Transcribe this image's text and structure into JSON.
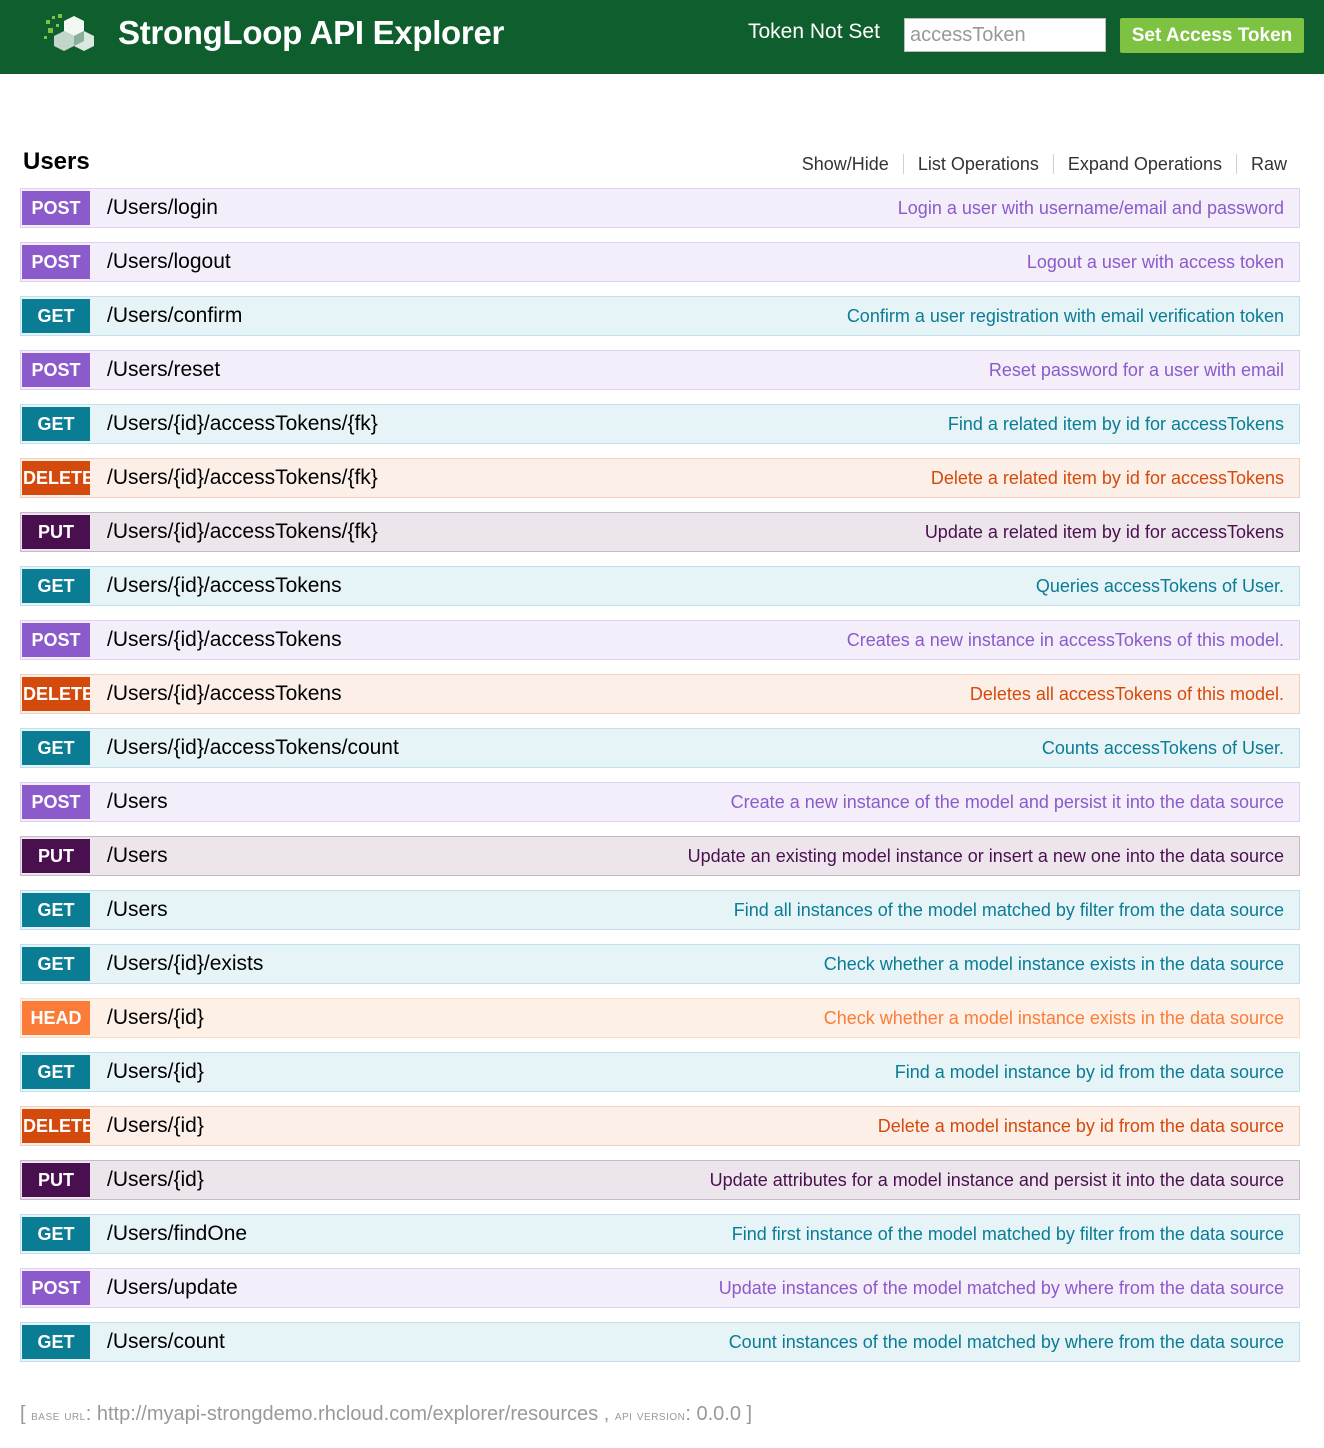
{
  "header": {
    "app_title": "StrongLoop API Explorer",
    "token_status": "Token Not Set",
    "token_input_placeholder": "accessToken",
    "token_button_label": "Set Access Token",
    "bar_color": "#0f5e2e",
    "button_color": "#7dc241"
  },
  "resource": {
    "title": "Users",
    "links": [
      "Show/Hide",
      "List Operations",
      "Expand Operations",
      "Raw"
    ]
  },
  "method_colors": {
    "POST": "#8b5acb",
    "GET": "#0a7c94",
    "DELETE": "#d44a0c",
    "PUT": "#4a0f4e",
    "HEAD": "#fb7c38"
  },
  "operations": [
    {
      "method": "POST",
      "path": "/Users/login",
      "summary": "Login a user with username/email and password"
    },
    {
      "method": "POST",
      "path": "/Users/logout",
      "summary": "Logout a user with access token"
    },
    {
      "method": "GET",
      "path": "/Users/confirm",
      "summary": "Confirm a user registration with email verification token"
    },
    {
      "method": "POST",
      "path": "/Users/reset",
      "summary": "Reset password for a user with email"
    },
    {
      "method": "GET",
      "path": "/Users/{id}/accessTokens/{fk}",
      "summary": "Find a related item by id for accessTokens"
    },
    {
      "method": "DELETE",
      "path": "/Users/{id}/accessTokens/{fk}",
      "summary": "Delete a related item by id for accessTokens"
    },
    {
      "method": "PUT",
      "path": "/Users/{id}/accessTokens/{fk}",
      "summary": "Update a related item by id for accessTokens"
    },
    {
      "method": "GET",
      "path": "/Users/{id}/accessTokens",
      "summary": "Queries accessTokens of User."
    },
    {
      "method": "POST",
      "path": "/Users/{id}/accessTokens",
      "summary": "Creates a new instance in accessTokens of this model."
    },
    {
      "method": "DELETE",
      "path": "/Users/{id}/accessTokens",
      "summary": "Deletes all accessTokens of this model."
    },
    {
      "method": "GET",
      "path": "/Users/{id}/accessTokens/count",
      "summary": "Counts accessTokens of User."
    },
    {
      "method": "POST",
      "path": "/Users",
      "summary": "Create a new instance of the model and persist it into the data source"
    },
    {
      "method": "PUT",
      "path": "/Users",
      "summary": "Update an existing model instance or insert a new one into the data source"
    },
    {
      "method": "GET",
      "path": "/Users",
      "summary": "Find all instances of the model matched by filter from the data source"
    },
    {
      "method": "GET",
      "path": "/Users/{id}/exists",
      "summary": "Check whether a model instance exists in the data source"
    },
    {
      "method": "HEAD",
      "path": "/Users/{id}",
      "summary": "Check whether a model instance exists in the data source"
    },
    {
      "method": "GET",
      "path": "/Users/{id}",
      "summary": "Find a model instance by id from the data source"
    },
    {
      "method": "DELETE",
      "path": "/Users/{id}",
      "summary": "Delete a model instance by id from the data source"
    },
    {
      "method": "PUT",
      "path": "/Users/{id}",
      "summary": "Update attributes for a model instance and persist it into the data source"
    },
    {
      "method": "GET",
      "path": "/Users/findOne",
      "summary": "Find first instance of the model matched by filter from the data source"
    },
    {
      "method": "POST",
      "path": "/Users/update",
      "summary": "Update instances of the model matched by where from the data source"
    },
    {
      "method": "GET",
      "path": "/Users/count",
      "summary": "Count instances of the model matched by where from the data source"
    }
  ],
  "footer": {
    "open_bracket": "[",
    "base_url_label": "base url",
    "base_url": "http://myapi-strongdemo.rhcloud.com/explorer/resources",
    "separator": ",",
    "api_version_label": "api version",
    "api_version": "0.0.0",
    "close_bracket": "]"
  }
}
